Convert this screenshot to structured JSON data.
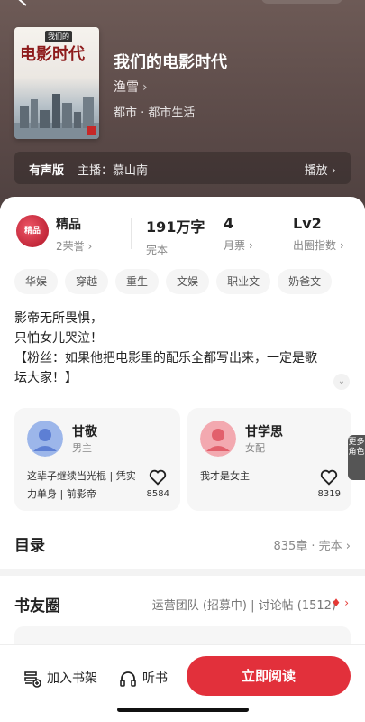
{
  "book": {
    "cover_title": "电影时代",
    "cover_tag": "我们的",
    "title": "我们的电影时代",
    "author": "渔雪",
    "category": "都市 · 都市生活",
    "audio_label": "有声版",
    "audio_host": "主播：慕山南",
    "audio_play": "播放"
  },
  "stats": {
    "badge_text": "精品",
    "quality_label": "精品",
    "quality_sub": "2荣誉",
    "words": "191万字",
    "words_sub": "完本",
    "tickets": "4",
    "tickets_sub": "月票",
    "level": "Lv2",
    "level_sub": "出圈指数"
  },
  "tags": [
    "华娱",
    "穿越",
    "重生",
    "文娱",
    "职业文",
    "奶爸文"
  ],
  "description": [
    "影帝无所畏惧，",
    "只怕女儿哭泣！",
    "【粉丝：如果他把电影里的配乐全都写出来，一定是歌",
    "坛大家！】"
  ],
  "characters": [
    {
      "name": "甘敬",
      "role": "男主",
      "quote": "这辈子继续当光棍 | 凭实力单身 | 前影帝",
      "likes": "8584"
    },
    {
      "name": "甘学思",
      "role": "女配",
      "quote": "我才是女主",
      "likes": "8319"
    }
  ],
  "more_roles": "更多角色",
  "toc": {
    "title": "目录",
    "meta": "835章 · 完本"
  },
  "friends": {
    "title": "书友圈",
    "meta": "运营团队 (招募中) | 讨论帖 (1512)"
  },
  "bottom": {
    "add_shelf": "加入书架",
    "listen": "听书",
    "read_now": "立即阅读"
  },
  "colors": {
    "accent": "#e2303b",
    "hero": "#5e4d4b"
  }
}
